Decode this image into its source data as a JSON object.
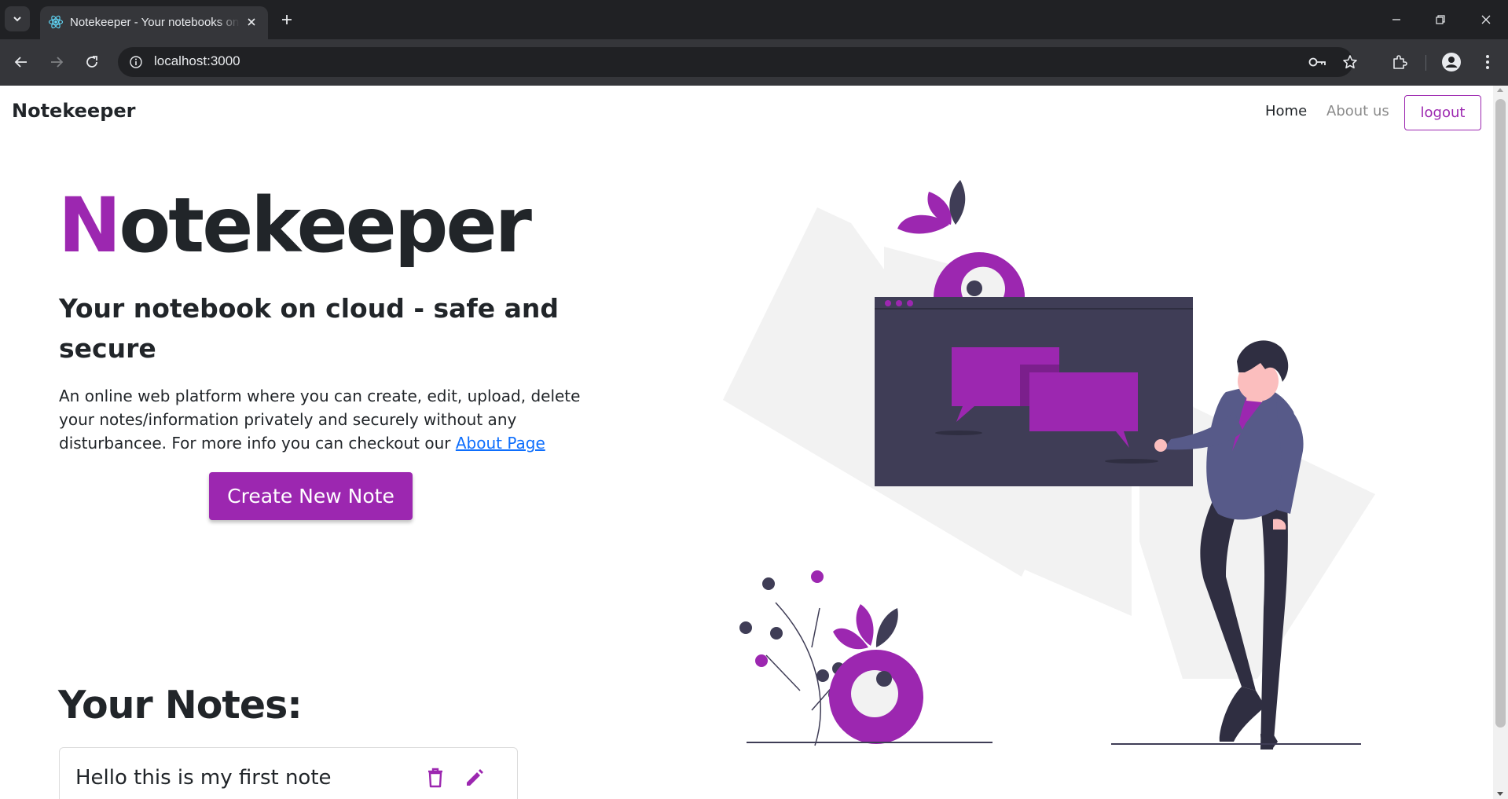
{
  "browser": {
    "tab_title": "Notekeeper - Your notebooks on cloud",
    "url": "localhost:3000"
  },
  "navbar": {
    "brand": "Notekeeper",
    "links": [
      "Home",
      "About us"
    ],
    "logout_label": "logout"
  },
  "hero": {
    "title_first_letter": "N",
    "title_rest": "otekeeper",
    "subtitle": "Your notebook on cloud - safe and secure",
    "description": "An online web platform where you can create, edit, upload, delete your notes/information privately and securely without any disturbancee. For more info you can checkout our",
    "about_link": "About Page",
    "create_button": "Create New Note"
  },
  "notes": {
    "heading": "Your Notes:",
    "items": [
      {
        "title": "Hello this is my first note"
      }
    ]
  },
  "colors": {
    "accent": "#9c27b0",
    "text": "#212529",
    "link": "#0d6efd",
    "illustration_dark": "#3f3d56",
    "illustration_light": "#f0f0f0"
  },
  "icons": [
    "tab-search-icon",
    "react-favicon-icon",
    "close-icon",
    "plus-icon",
    "minimize-icon",
    "restore-icon",
    "back-icon",
    "forward-icon",
    "reload-icon",
    "site-info-icon",
    "password-key-icon",
    "star-icon",
    "extensions-icon",
    "profile-icon",
    "menu-icon",
    "trash-icon",
    "pencil-icon"
  ]
}
